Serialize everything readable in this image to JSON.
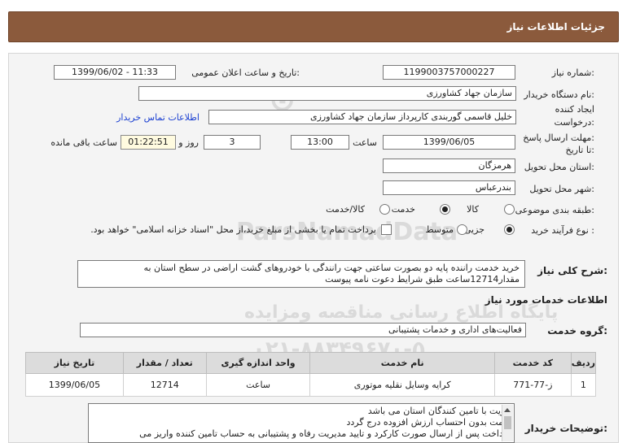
{
  "header": {
    "title": "جزئیات اطلاعات نیاز"
  },
  "watermark": {
    "brand": "ParsNamadData",
    "line1": "پایگاه اطلاع رسانی مناقصه ومزایده",
    "phone": "۰۲۱-۸۸۳۴۹۶۷۰-۵"
  },
  "fields": {
    "need_number_label": "شماره نیاز:",
    "need_number": "1199003757000227",
    "announce_label": "تاریخ و ساعت اعلان عمومی:",
    "announce_value": "1399/06/02 - 11:33",
    "buyer_org_label": "نام دستگاه خریدار:",
    "buyer_org": "سازمان جهاد کشاورزی",
    "creator_label_1": "ایجاد کننده",
    "creator_label_2": "درخواست:",
    "creator": "خلیل قاسمی گوربندی کارپرداز سازمان جهاد کشاورزی",
    "contact_link": "اطلاعات تماس خریدار",
    "deadline_label_1": "مهلت ارسال پاسخ:",
    "deadline_label_2": "تا تاریخ:",
    "deadline_date": "1399/06/05",
    "time_label": "ساعت",
    "deadline_time": "13:00",
    "days_value": "3",
    "days_label": "روز و",
    "remaining_time": "01:22:51",
    "remaining_label": "ساعت باقی مانده",
    "province_label": "استان محل تحویل:",
    "province": "هرمزگان",
    "city_label": "شهر محل تحویل:",
    "city": "بندرعباس",
    "category_label": "طبقه بندی موضوعی:",
    "category_options": [
      "کالا",
      "خدمت",
      "کالا/خدمت"
    ],
    "category_selected": "خدمت",
    "purchase_type_label": "نوع فرآیند خرید :",
    "purchase_options": [
      "جزیی",
      "متوسط"
    ],
    "purchase_selected": "جزیی",
    "payment_note": "پرداخت تمام یا بخشی از مبلغ خرید،از محل \"اسناد خزانه اسلامی\" خواهد بود."
  },
  "summary": {
    "label": "شرح کلی نیاز:",
    "text": "خرید خدمت راننده پایه دو بصورت ساعتی جهت رانندگی با خودروهای گشت اراضی در سطح استان به مقدار12714ساعت طبق شرایط دعوت نامه پیوست"
  },
  "services": {
    "section_title": "اطلاعات خدمات مورد نیاز",
    "group_label": "گروه خدمت:",
    "group_value": "فعالیت‌های اداری و خدمات پشتیبانی",
    "columns": [
      "ردیف",
      "کد خدمت",
      "نام خدمت",
      "واحد اندازه گیری",
      "تعداد / مقدار",
      "تاریخ نیاز"
    ],
    "rows": [
      [
        "1",
        "ز-77-771",
        "کرایه وسایل نقلیه موتوری",
        "ساعت",
        "12714",
        "1399/06/05"
      ]
    ]
  },
  "notes": {
    "label": "توضیحات خریدار:",
    "lines": [
      "الویت با تامین کنندگان استان می باشد",
      "قیمت بدون احتساب ارزش افزوده درج گردد",
      "پرداخت پس از ارسال صورت کارکرد و تایید مدیریت رفاه و پشتیبانی  به حساب تامین کننده واریز می"
    ]
  }
}
